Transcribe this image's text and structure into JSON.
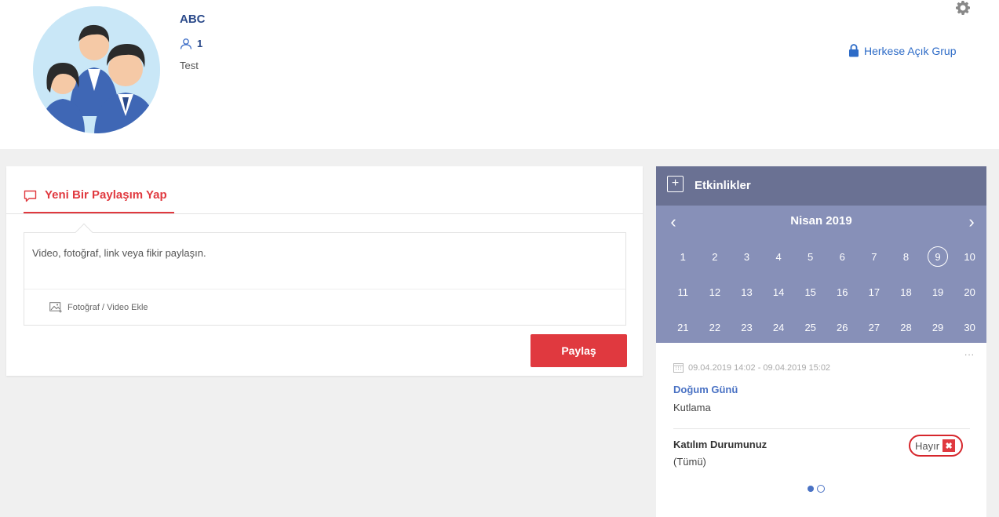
{
  "header": {
    "group_name": "ABC",
    "member_count": "1",
    "description": "Test",
    "privacy_label": "Herkese Açık Grup"
  },
  "post": {
    "tab_label": "Yeni Bir Paylaşım Yap",
    "placeholder": "Video, fotoğraf, link veya fikir paylaşın.",
    "add_media_label": "Fotoğraf / Video Ekle",
    "share_label": "Paylaş"
  },
  "events": {
    "title": "Etkinlikler",
    "calendar": {
      "month": "Nisan 2019",
      "selected_day": "9",
      "days": [
        "1",
        "2",
        "3",
        "4",
        "5",
        "6",
        "7",
        "8",
        "9",
        "10",
        "11",
        "12",
        "13",
        "14",
        "15",
        "16",
        "17",
        "18",
        "19",
        "20",
        "21",
        "22",
        "23",
        "24",
        "25",
        "26",
        "27",
        "28",
        "29",
        "30"
      ]
    },
    "event": {
      "more": "...",
      "date_range": "09.04.2019 14:02 - 09.04.2019 15:02",
      "title": "Doğum Günü",
      "description": "Kutlama",
      "attendance_label": "Katılım Durumunuz",
      "attendance_filter": "(Tümü)",
      "attendance_status": "Hayır"
    }
  },
  "colors": {
    "accent_red": "#e0393f",
    "brand_blue": "#2b4a8a",
    "events_header": "#6a7193",
    "calendar_bg": "#8790b8"
  }
}
